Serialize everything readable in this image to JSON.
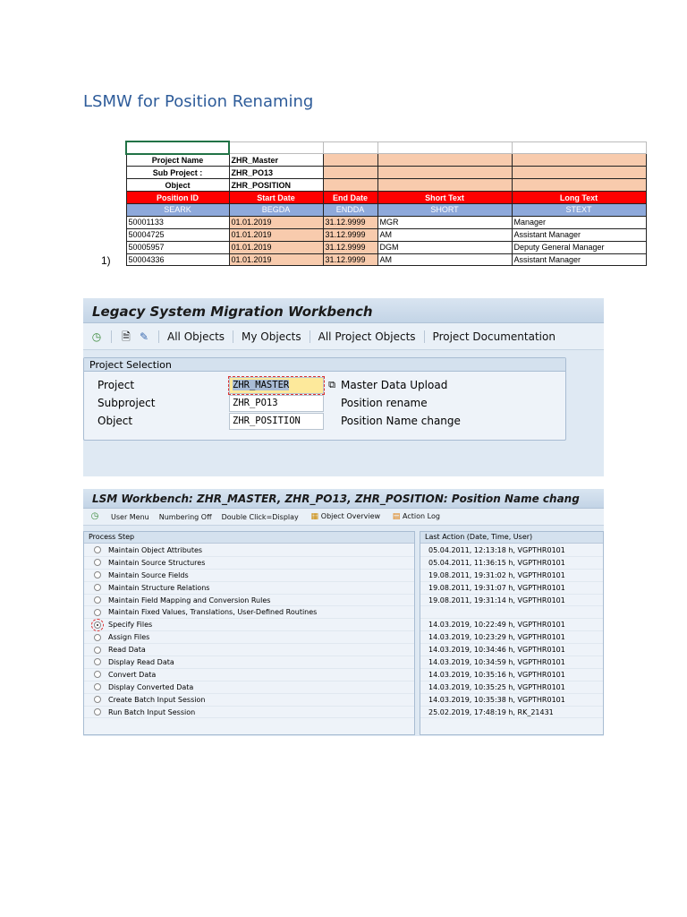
{
  "doc_title": "LSMW for Position Renaming",
  "marker": "1)",
  "sheet": {
    "meta": [
      {
        "label": "Project Name",
        "value": "ZHR_Master"
      },
      {
        "label": "Sub Project :",
        "value": "ZHR_PO13"
      },
      {
        "label": "Object",
        "value": "ZHR_POSITION"
      }
    ],
    "headers": [
      "Position ID",
      "Start Date",
      "End Date",
      "Short Text",
      "Long Text"
    ],
    "fields": [
      "SEARK",
      "BEGDA",
      "ENDDA",
      "SHORT",
      "STEXT"
    ],
    "rows": [
      [
        "50001133",
        "01.01.2019",
        "31.12.9999",
        "MGR",
        "Manager"
      ],
      [
        "50004725",
        "01.01.2019",
        "31.12.9999",
        "AM",
        "Assistant Manager"
      ],
      [
        "50005957",
        "01.01.2019",
        "31.12.9999",
        "DGM",
        "Deputy General Manager"
      ],
      [
        "50004336",
        "01.01.2019",
        "31.12.9999",
        "AM",
        "Assistant Manager"
      ]
    ]
  },
  "lsmw": {
    "title": "Legacy System Migration Workbench",
    "toolbar": [
      "All Objects",
      "My Objects",
      "All Project Objects",
      "Project Documentation"
    ],
    "group_title": "Project Selection",
    "fields": [
      {
        "label": "Project",
        "value": "ZHR_MASTER",
        "desc": "Master Data Upload"
      },
      {
        "label": "Subproject",
        "value": "ZHR_PO13",
        "desc": "Position rename"
      },
      {
        "label": "Object",
        "value": "ZHR_POSITION",
        "desc": "Position Name change"
      }
    ]
  },
  "wb": {
    "title": "LSM Workbench: ZHR_MASTER, ZHR_PO13, ZHR_POSITION: Position Name chang",
    "toolbar": [
      "User Menu",
      "Numbering Off",
      "Double Click=Display",
      "Object Overview",
      "Action Log"
    ],
    "step_header": "Process Step",
    "action_header": "Last Action (Date, Time, User)",
    "selected_step": 6,
    "steps": [
      {
        "name": "Maintain Object Attributes",
        "last": "05.04.2011, 12:13:18 h, VGPTHR0101"
      },
      {
        "name": "Maintain Source Structures",
        "last": "05.04.2011, 11:36:15 h, VGPTHR0101"
      },
      {
        "name": "Maintain Source Fields",
        "last": "19.08.2011, 19:31:02 h, VGPTHR0101"
      },
      {
        "name": "Maintain Structure Relations",
        "last": "19.08.2011, 19:31:07 h, VGPTHR0101"
      },
      {
        "name": "Maintain Field Mapping and Conversion Rules",
        "last": "19.08.2011, 19:31:14 h, VGPTHR0101"
      },
      {
        "name": "Maintain Fixed Values, Translations, User-Defined Routines",
        "last": ""
      },
      {
        "name": "Specify Files",
        "last": "14.03.2019, 10:22:49 h, VGPTHR0101"
      },
      {
        "name": "Assign Files",
        "last": "14.03.2019, 10:23:29 h, VGPTHR0101"
      },
      {
        "name": "Read Data",
        "last": "14.03.2019, 10:34:46 h, VGPTHR0101"
      },
      {
        "name": "Display Read Data",
        "last": "14.03.2019, 10:34:59 h, VGPTHR0101"
      },
      {
        "name": "Convert Data",
        "last": "14.03.2019, 10:35:16 h, VGPTHR0101"
      },
      {
        "name": "Display Converted Data",
        "last": "14.03.2019, 10:35:25 h, VGPTHR0101"
      },
      {
        "name": "Create Batch Input Session",
        "last": "14.03.2019, 10:35:38 h, VGPTHR0101"
      },
      {
        "name": "Run Batch Input Session",
        "last": "25.02.2019, 17:48:19 h, RK_21431"
      }
    ]
  }
}
